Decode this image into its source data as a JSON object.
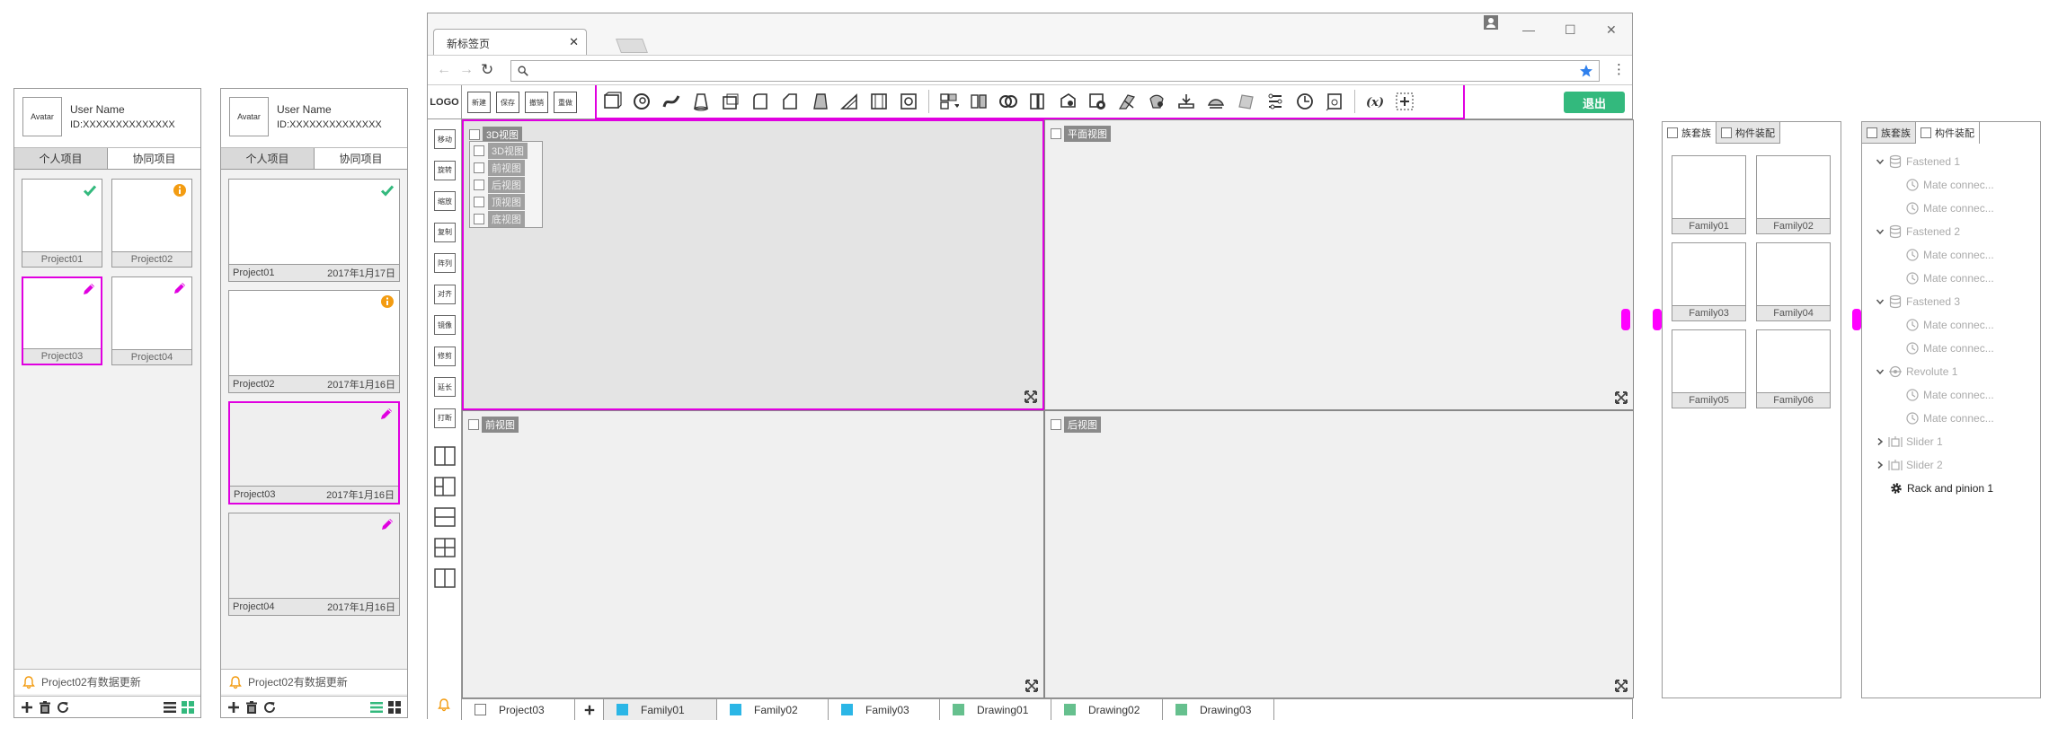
{
  "colors": {
    "accent": "#e000e0",
    "green": "#33b97d",
    "orange": "#f39c12",
    "family_blue": "#2bb6e6",
    "drawing_green": "#66c08e"
  },
  "panel1": {
    "avatar": "Avatar",
    "user_name": "User Name",
    "user_id": "ID:XXXXXXXXXXXXXX",
    "tabs": [
      "个人项目",
      "协同项目"
    ],
    "projects": [
      {
        "name": "Project01",
        "badge": "check-icon"
      },
      {
        "name": "Project02",
        "badge": "info-icon"
      },
      {
        "name": "Project03",
        "badge": "pencil-icon"
      },
      {
        "name": "Project04",
        "badge": "pencil-icon"
      }
    ],
    "notification": "Project02有数据更新"
  },
  "panel2": {
    "avatar": "Avatar",
    "user_name": "User Name",
    "user_id": "ID:XXXXXXXXXXXXXX",
    "tabs": [
      "个人项目",
      "协同项目"
    ],
    "projects": [
      {
        "name": "Project01",
        "date": "2017年1月17日",
        "badge": "check-icon"
      },
      {
        "name": "Project02",
        "date": "2017年1月16日",
        "badge": "info-icon"
      },
      {
        "name": "Project03",
        "date": "2017年1月16日",
        "badge": "pencil-icon"
      },
      {
        "name": "Project04",
        "date": "2017年1月16日",
        "badge": "pencil-icon"
      }
    ],
    "notification": "Project02有数据更新"
  },
  "browser": {
    "tab_title": "新标签页",
    "url": "",
    "logo": "LOGO",
    "file_buttons": [
      "新建",
      "保存",
      "撤销",
      "重做"
    ],
    "exit": "退出",
    "left_tools": [
      "移动",
      "旋转",
      "缩放",
      "复制",
      "阵列",
      "对齐",
      "镜像",
      "修剪",
      "延长",
      "打断"
    ],
    "viewports": {
      "top_left": "3D视图",
      "top_right": "平面视图",
      "bottom_left": "前视图",
      "bottom_right": "后视图"
    },
    "view_menu": [
      "3D视图",
      "前视图",
      "后视图",
      "顶视图",
      "底视图"
    ],
    "bottom_tabs": [
      {
        "label": "Project03",
        "kind": "project"
      },
      {
        "label": "+",
        "kind": "add"
      },
      {
        "label": "Family01",
        "kind": "family"
      },
      {
        "label": "Family02",
        "kind": "family"
      },
      {
        "label": "Family03",
        "kind": "family"
      },
      {
        "label": "Drawing01",
        "kind": "drawing"
      },
      {
        "label": "Drawing02",
        "kind": "drawing"
      },
      {
        "label": "Drawing03",
        "kind": "drawing"
      }
    ]
  },
  "panel3": {
    "tabs": [
      "族套族",
      "构件装配"
    ],
    "families": [
      "Family01",
      "Family02",
      "Family03",
      "Family04",
      "Family05",
      "Family06"
    ]
  },
  "panel4": {
    "tabs": [
      "族套族",
      "构件装配"
    ],
    "tree": [
      {
        "label": "Fastened 1",
        "type": "group",
        "expanded": true
      },
      {
        "label": "Mate connec...",
        "type": "child"
      },
      {
        "label": "Mate connec...",
        "type": "child"
      },
      {
        "label": "Fastened 2",
        "type": "group",
        "expanded": true
      },
      {
        "label": "Mate connec...",
        "type": "child"
      },
      {
        "label": "Mate connec...",
        "type": "child"
      },
      {
        "label": "Fastened 3",
        "type": "group",
        "expanded": true
      },
      {
        "label": "Mate connec...",
        "type": "child"
      },
      {
        "label": "Mate connec...",
        "type": "child"
      },
      {
        "label": "Revolute 1",
        "type": "group",
        "expanded": true
      },
      {
        "label": "Mate connec...",
        "type": "child"
      },
      {
        "label": "Mate connec...",
        "type": "child"
      },
      {
        "label": "Slider 1",
        "type": "group",
        "expanded": false
      },
      {
        "label": "Slider 2",
        "type": "group",
        "expanded": false
      },
      {
        "label": "Rack and pinion 1",
        "type": "leaf"
      }
    ]
  }
}
